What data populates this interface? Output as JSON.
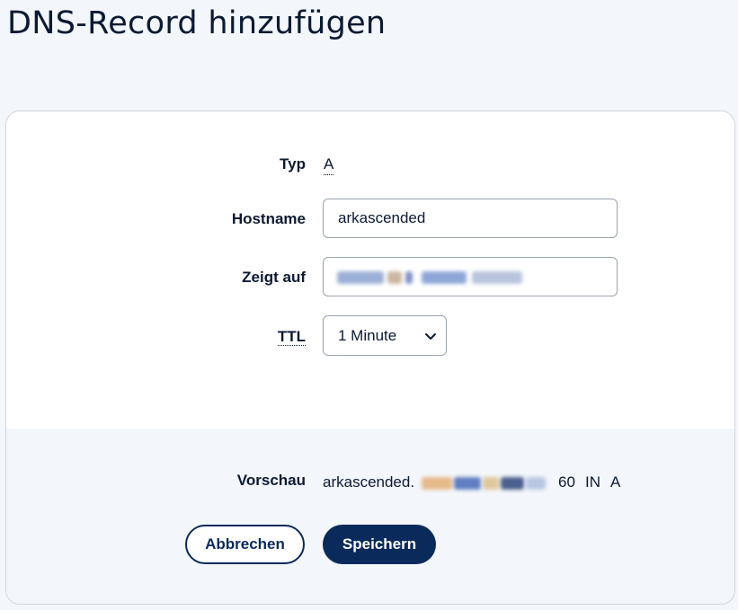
{
  "page": {
    "title": "DNS-Record hinzufügen"
  },
  "form": {
    "type": {
      "label": "Typ",
      "value": "A"
    },
    "hostname": {
      "label": "Hostname",
      "value": "arkascended"
    },
    "points_to": {
      "label": "Zeigt auf",
      "value": ""
    },
    "ttl": {
      "label": "TTL",
      "selected": "1 Minute"
    }
  },
  "preview": {
    "label": "Vorschau",
    "host": "arkascended.",
    "ttl": "60",
    "class": "IN",
    "type": "A"
  },
  "actions": {
    "cancel_label": "Abbrechen",
    "save_label": "Speichern"
  },
  "colors": {
    "primary": "#0b2a5c",
    "text": "#0b1a33",
    "background": "#f3f6fa",
    "border": "#9aa3ae"
  }
}
